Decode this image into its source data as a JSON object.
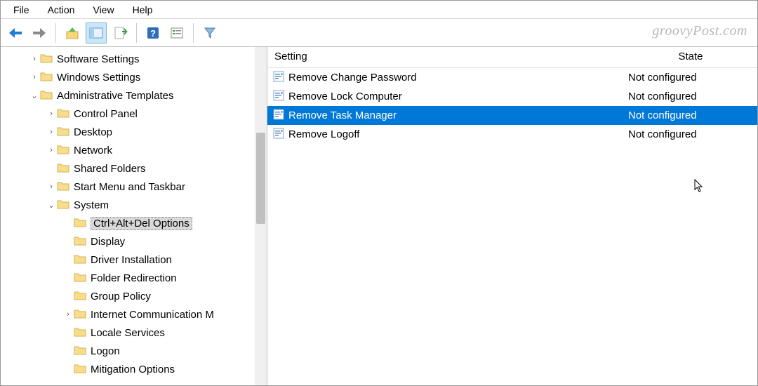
{
  "menubar": [
    "File",
    "Action",
    "View",
    "Help"
  ],
  "watermark": "groovyPost.com",
  "tree": [
    {
      "depth": 0,
      "expander": "›",
      "label": "Software Settings"
    },
    {
      "depth": 0,
      "expander": "›",
      "label": "Windows Settings"
    },
    {
      "depth": 0,
      "expander": "⌄",
      "label": "Administrative Templates"
    },
    {
      "depth": 1,
      "expander": "›",
      "label": "Control Panel"
    },
    {
      "depth": 1,
      "expander": "›",
      "label": "Desktop"
    },
    {
      "depth": 1,
      "expander": "›",
      "label": "Network"
    },
    {
      "depth": 1,
      "expander": "",
      "label": "Shared Folders"
    },
    {
      "depth": 1,
      "expander": "›",
      "label": "Start Menu and Taskbar"
    },
    {
      "depth": 1,
      "expander": "⌄",
      "label": "System"
    },
    {
      "depth": 2,
      "expander": "",
      "label": "Ctrl+Alt+Del Options",
      "selected": true
    },
    {
      "depth": 2,
      "expander": "",
      "label": "Display"
    },
    {
      "depth": 2,
      "expander": "",
      "label": "Driver Installation"
    },
    {
      "depth": 2,
      "expander": "",
      "label": "Folder Redirection"
    },
    {
      "depth": 2,
      "expander": "",
      "label": "Group Policy"
    },
    {
      "depth": 2,
      "expander": "›",
      "label": "Internet Communication M"
    },
    {
      "depth": 2,
      "expander": "",
      "label": "Locale Services"
    },
    {
      "depth": 2,
      "expander": "",
      "label": "Logon"
    },
    {
      "depth": 2,
      "expander": "",
      "label": "Mitigation Options"
    }
  ],
  "list_header": {
    "setting": "Setting",
    "state": "State"
  },
  "settings": [
    {
      "name": "Remove Change Password",
      "state": "Not configured"
    },
    {
      "name": "Remove Lock Computer",
      "state": "Not configured"
    },
    {
      "name": "Remove Task Manager",
      "state": "Not configured",
      "selected": true
    },
    {
      "name": "Remove Logoff",
      "state": "Not configured"
    }
  ]
}
